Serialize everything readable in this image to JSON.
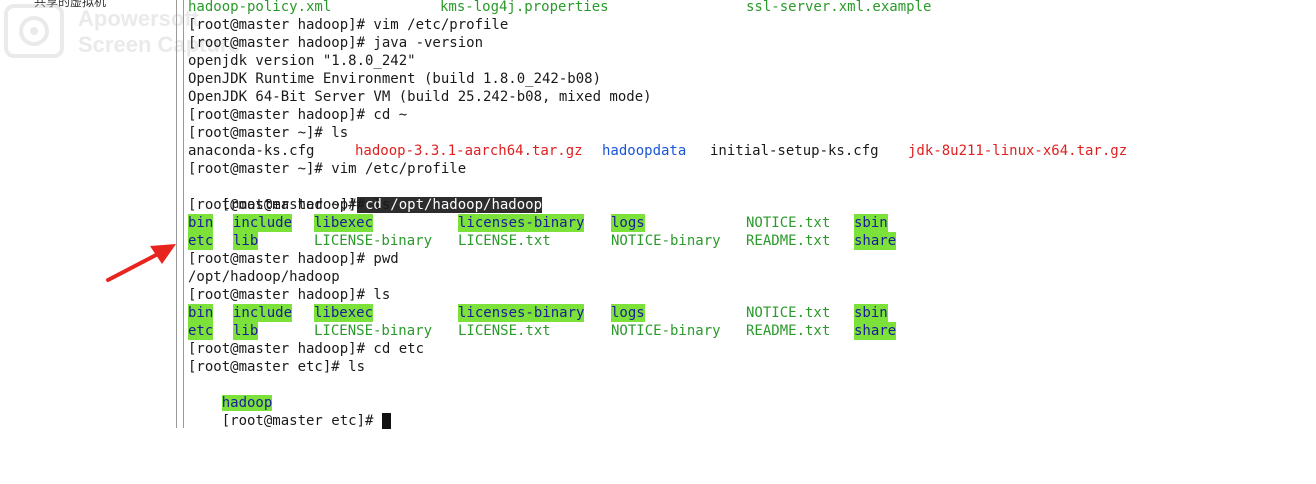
{
  "sidebar": {
    "title": "共享的虚拟机"
  },
  "watermark": {
    "line1": "Apowersoft",
    "line2": "Screen Capture"
  },
  "terminal": {
    "line0": [
      "hadoop-policy.xml",
      "kms-log4j.properties",
      "ssl-server.xml.example"
    ],
    "line1": "[root@master hadoop]# vim /etc/profile",
    "line2": "[root@master hadoop]# java -version",
    "line3": "openjdk version \"1.8.0_242\"",
    "line4": "OpenJDK Runtime Environment (build 1.8.0_242-b08)",
    "line5": "OpenJDK 64-Bit Server VM (build 25.242-b08, mixed mode)",
    "line6": "[root@master hadoop]# cd ~",
    "line7": "[root@master ~]# ls",
    "line8": [
      "anaconda-ks.cfg",
      "hadoop-3.3.1-aarch64.tar.gz",
      "hadoopdata",
      "initial-setup-ks.cfg",
      "jdk-8u211-linux-x64.tar.gz"
    ],
    "line9": "[root@master ~]# vim /etc/profile",
    "line10_prompt": "[root@master ~]#",
    "line10_cmd": " cd /opt/hadoop/hadoop",
    "line11": "[root@master hadoop]# ls",
    "ls_row1": [
      "bin",
      "include",
      "libexec",
      "licenses-binary",
      "logs",
      "NOTICE.txt",
      "sbin"
    ],
    "ls_row2": [
      "etc",
      "lib",
      "LICENSE-binary",
      "LICENSE.txt",
      "NOTICE-binary",
      "README.txt",
      "share"
    ],
    "line14": "[root@master hadoop]# pwd",
    "line15": "/opt/hadoop/hadoop",
    "line16": "[root@master hadoop]# ls",
    "line19": "[root@master hadoop]# cd etc",
    "line20": "[root@master etc]# ls",
    "line21": "hadoop",
    "line22": "[root@master etc]# "
  },
  "colors": {
    "green_text": "#2b9a2b",
    "red_archive": "#e02020",
    "blue_dir": "#1a55d8",
    "dir_highlight": "#7ce23a",
    "arrow": "#e8241f"
  },
  "icons": [
    "watermark-logo-icon",
    "annotation-arrow-icon"
  ]
}
